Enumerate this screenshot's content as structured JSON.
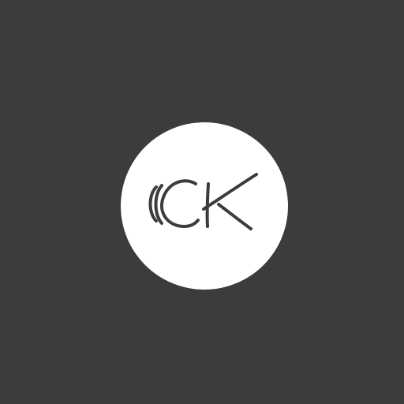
{
  "logo": {
    "monogram": "CK",
    "icon": "ck-monogram-icon"
  },
  "colors": {
    "background": "#3c3c3c",
    "circle": "#ffffff",
    "glyph": "#3c3c3c"
  }
}
